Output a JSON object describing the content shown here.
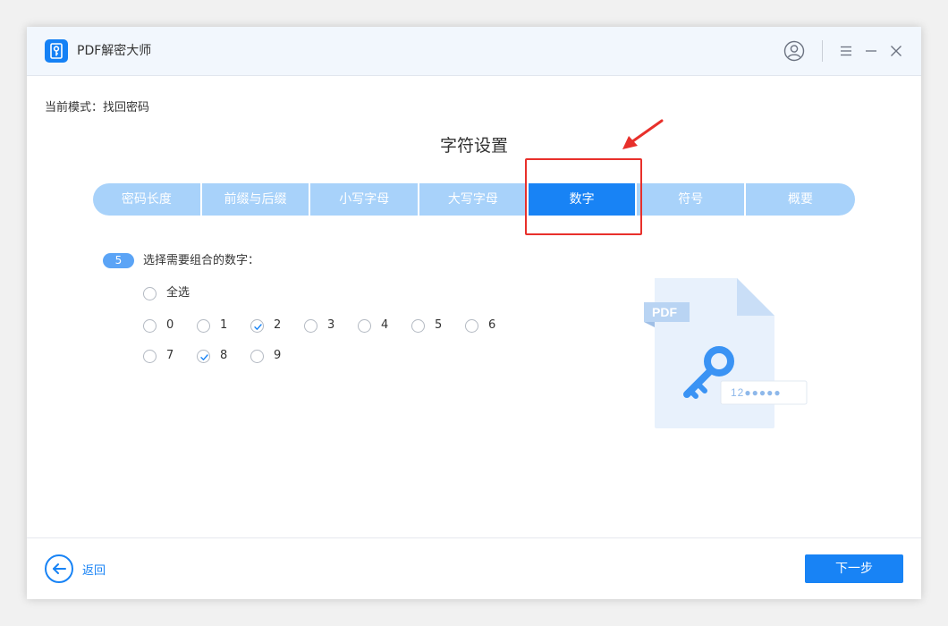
{
  "window": {
    "title": "PDF解密大师"
  },
  "mode": {
    "label": "当前模式：找回密码"
  },
  "section": {
    "title": "字符设置"
  },
  "tabs": [
    {
      "label": "密码长度",
      "active": false
    },
    {
      "label": "前缀与后缀",
      "active": false
    },
    {
      "label": "小写字母",
      "active": false
    },
    {
      "label": "大写字母",
      "active": false
    },
    {
      "label": "数字",
      "active": true
    },
    {
      "label": "符号",
      "active": false
    },
    {
      "label": "概要",
      "active": false
    }
  ],
  "step": {
    "number": "5",
    "question": "选择需要组合的数字："
  },
  "select_all": {
    "label": "全选",
    "checked": false
  },
  "digits": [
    {
      "label": "0",
      "checked": false
    },
    {
      "label": "1",
      "checked": false
    },
    {
      "label": "2",
      "checked": true
    },
    {
      "label": "3",
      "checked": false
    },
    {
      "label": "4",
      "checked": false
    },
    {
      "label": "5",
      "checked": false
    },
    {
      "label": "6",
      "checked": false
    },
    {
      "label": "7",
      "checked": false
    },
    {
      "label": "8",
      "checked": true
    },
    {
      "label": "9",
      "checked": false
    }
  ],
  "illustration": {
    "badge": "PDF",
    "password_hint": "12●●●●●"
  },
  "footer": {
    "back_label": "返回",
    "next_label": "下一步"
  },
  "icons": {
    "app": "key-doc-icon",
    "user": "user-icon",
    "menu": "menu-icon",
    "minimize": "minimize-icon",
    "close": "close-icon",
    "back": "arrow-left-icon"
  },
  "colors": {
    "accent": "#1883f5",
    "tab_inactive": "#a8d2fa",
    "highlight": "#e8302b"
  }
}
